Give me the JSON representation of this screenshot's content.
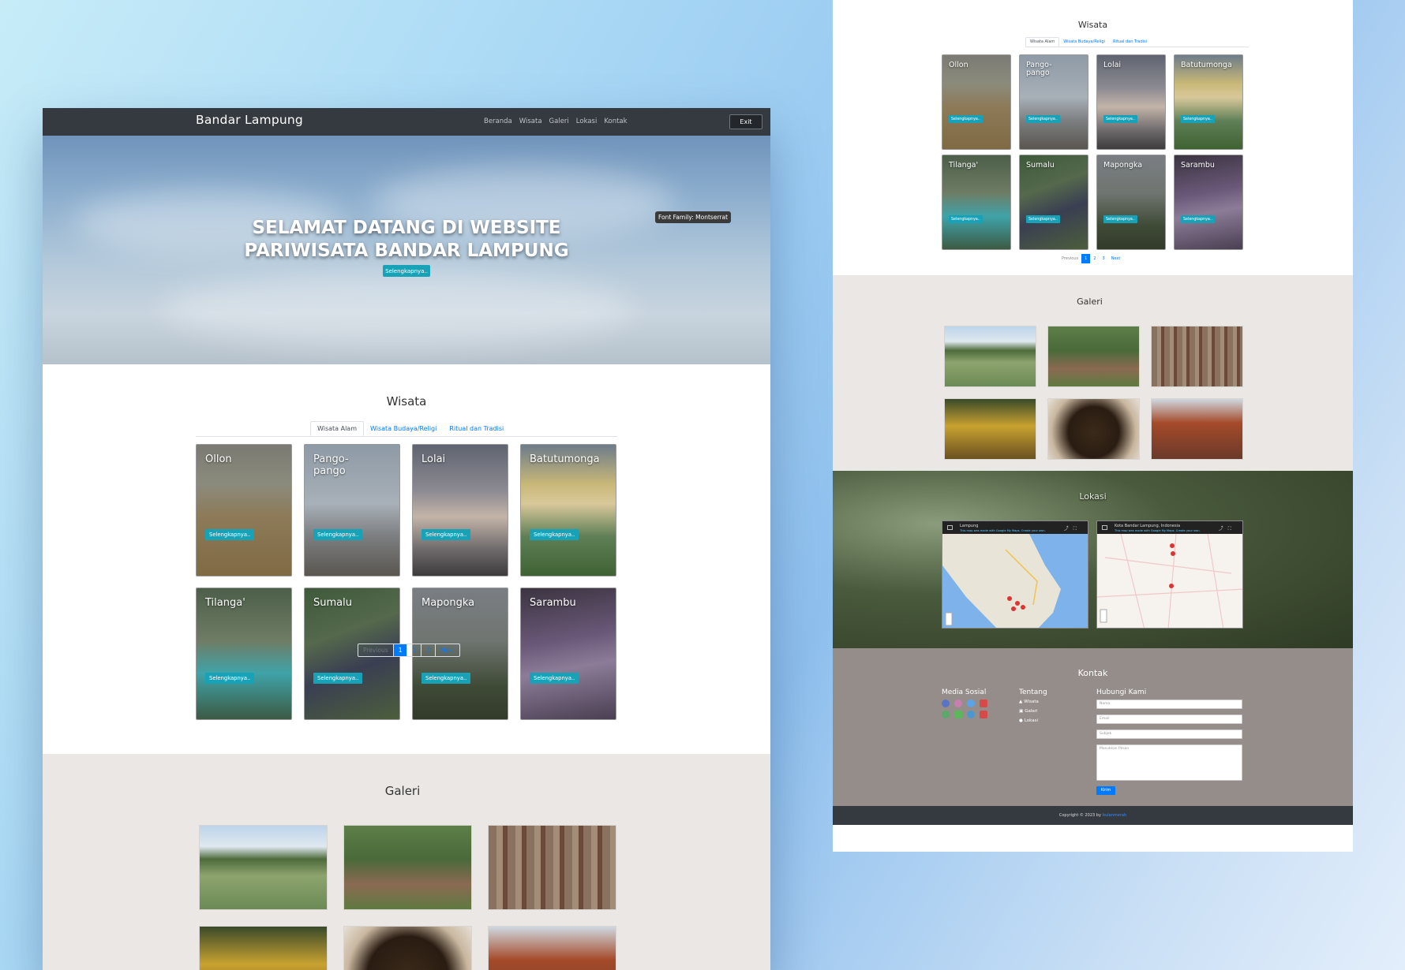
{
  "nav": {
    "brand": "Bandar Lampung",
    "links": [
      "Beranda",
      "Wisata",
      "Galeri",
      "Lokasi",
      "Kontak"
    ],
    "exit": "Exit"
  },
  "hero": {
    "title_line1": "SELAMAT DATANG DI WEBSITE",
    "title_line2": "PARIWISATA BANDAR LAMPUNG",
    "button": "Selengkapnya..",
    "font_tooltip": "Font Family: Montserrat"
  },
  "wisata": {
    "title": "Wisata",
    "tabs": [
      "Wisata Alam",
      "Wisata Budaya/Religi",
      "Ritual dan Tradisi"
    ],
    "cards": [
      {
        "name": "Ollon",
        "button": "Selengkapnya.."
      },
      {
        "name": "Pango-pango",
        "button": "Selengkapnya.."
      },
      {
        "name": "Lolai",
        "button": "Selengkapnya.."
      },
      {
        "name": "Batutumonga",
        "button": "Selengkapnya.."
      },
      {
        "name": "Tilanga'",
        "button": "Selengkapnya.."
      },
      {
        "name": "Sumalu",
        "button": "Selengkapnya.."
      },
      {
        "name": "Mapongka",
        "button": "Selengkapnya.."
      },
      {
        "name": "Sarambu",
        "button": "Selengkapnya.."
      }
    ],
    "pager": {
      "prev": "Previous",
      "pages": [
        "1",
        "2",
        "3"
      ],
      "next": "Next",
      "current": "1"
    }
  },
  "galeri": {
    "title": "Galeri"
  },
  "lokasi": {
    "title": "Lokasi",
    "map1_title": "Lampung",
    "map2_title": "Kota Bandar Lampung, Indonesia",
    "map_note": "This map was made with Google My Maps. Create your own."
  },
  "kontak": {
    "title": "Kontak",
    "media_sosial": "Media Sosial",
    "tentang": "Tentang",
    "tentang_links": [
      "Wisata",
      "Galeri",
      "Lokasi"
    ],
    "hubungi": "Hubungi Kami",
    "placeholders": {
      "nama": "Nama",
      "email": "Email",
      "subjek": "Subjek",
      "pesan": "Masukkan Pesan"
    },
    "kirim": "Kirim"
  },
  "footer": {
    "text": "Copyright © 2023 by",
    "author": "bulanmerah"
  },
  "colors": {
    "navbar": "#343a40",
    "accent": "#17a2b8",
    "primary": "#007bff",
    "galeri_bg": "#ebe7e5",
    "kontak_bg": "#958d8a"
  }
}
